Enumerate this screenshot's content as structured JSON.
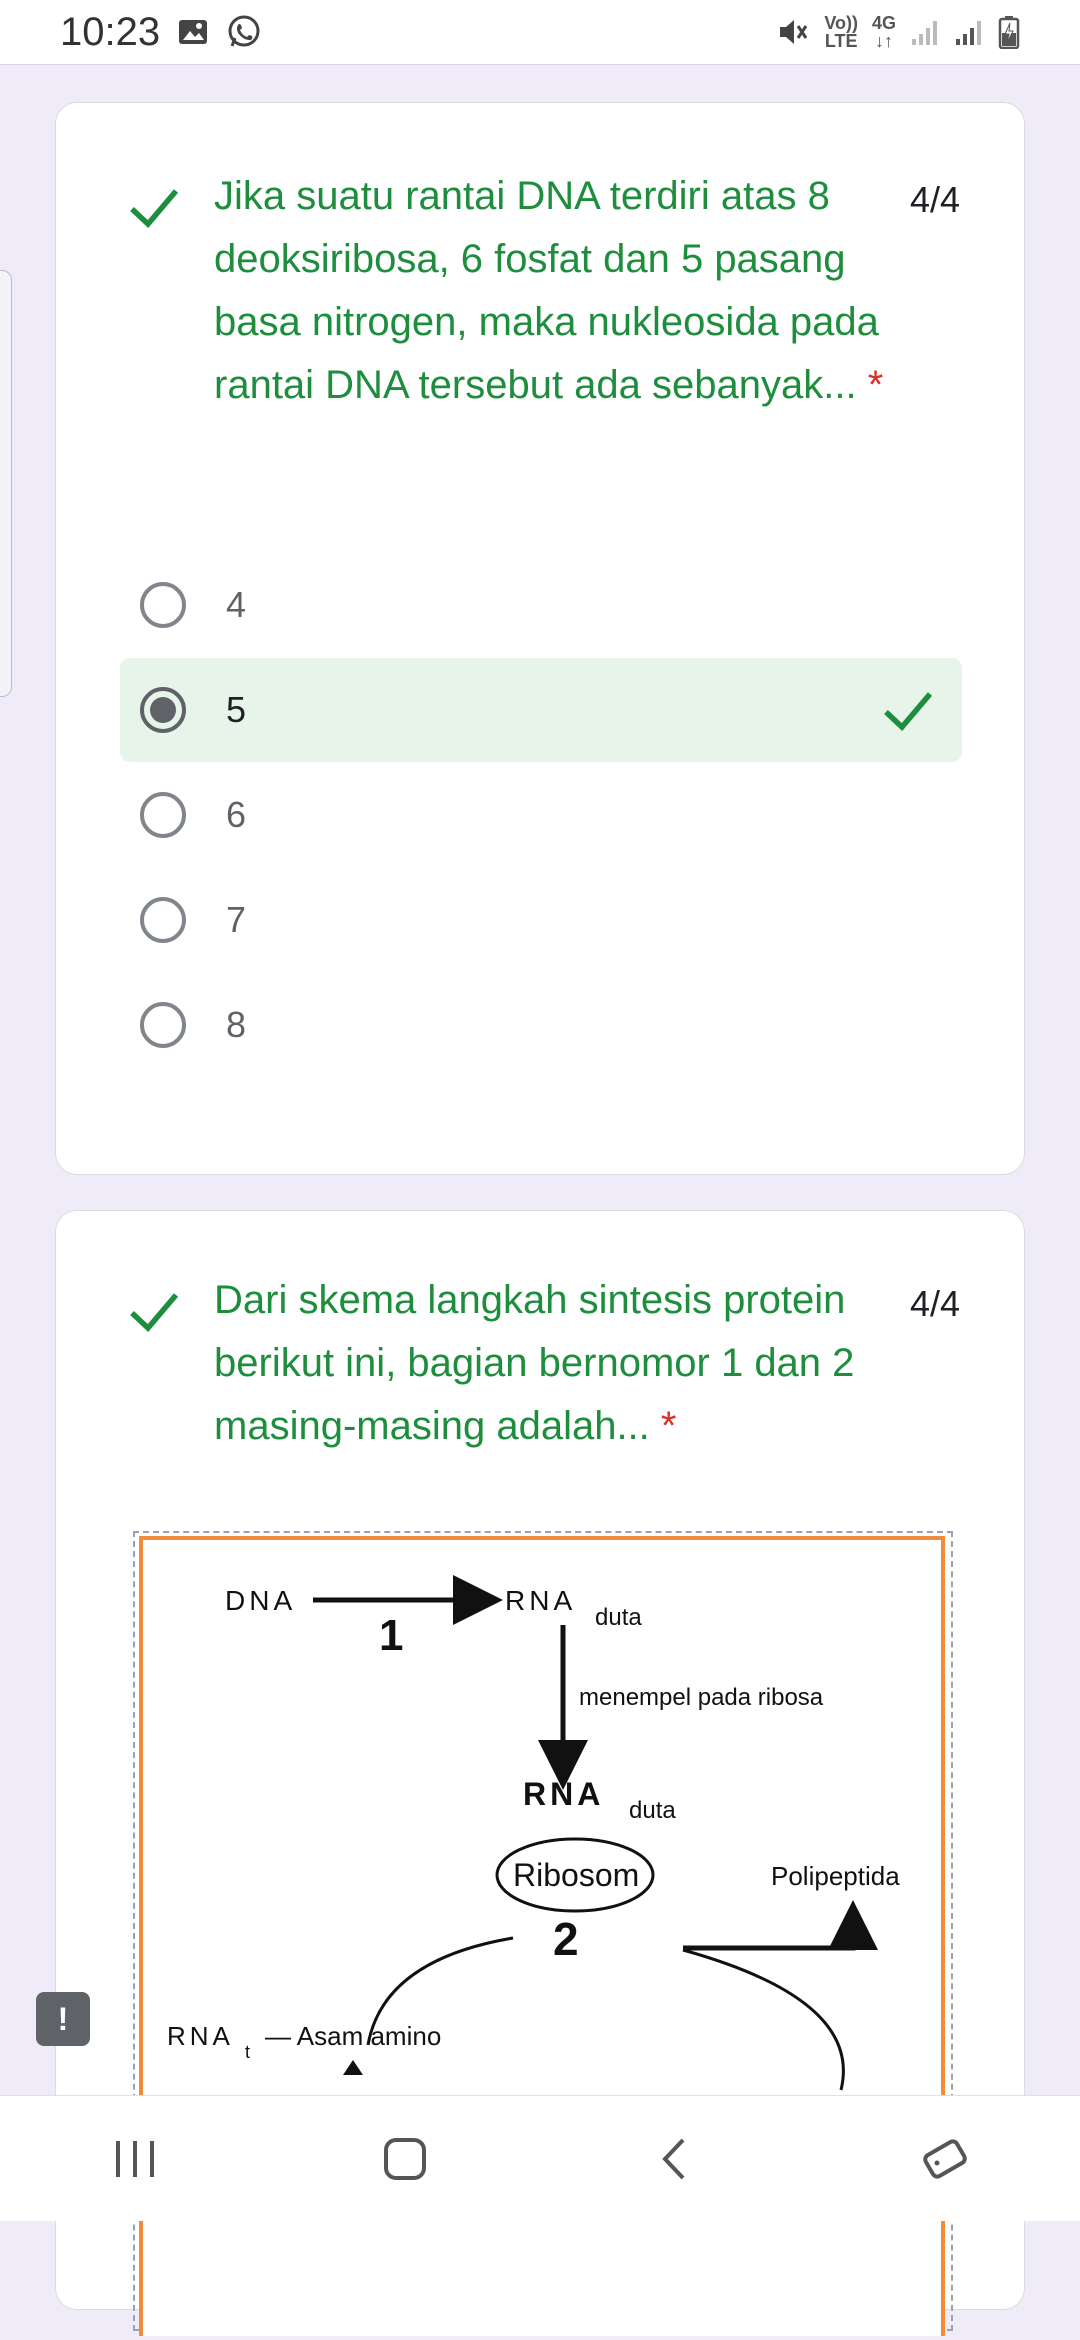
{
  "status_bar": {
    "time": "10:23",
    "network_volte": "Vo))",
    "network_lte": "LTE",
    "network_4g": "4G",
    "icons": [
      "gallery-icon",
      "whatsapp-icon",
      "mute-icon",
      "signal-icon",
      "signal-icon",
      "battery-charging-icon"
    ]
  },
  "question1": {
    "text": "Jika suatu rantai DNA terdiri atas 8 deoksiribosa, 6 fosfat dan 5 pasang basa nitrogen, maka nukleosida pada rantai DNA tersebut ada sebanyak...",
    "required_mark": "*",
    "score": "4/4",
    "options": [
      {
        "label": "4",
        "selected": false
      },
      {
        "label": "5",
        "selected": true,
        "correct": true
      },
      {
        "label": "6",
        "selected": false
      },
      {
        "label": "7",
        "selected": false
      },
      {
        "label": "8",
        "selected": false
      }
    ]
  },
  "question2": {
    "text": "Dari skema langkah sintesis protein berikut ini, bagian bernomor 1 dan 2 masing-masing adalah...",
    "required_mark": "*",
    "score": "4/4",
    "diagram": {
      "dna": "DNA",
      "num1": "1",
      "rna": "RNA",
      "duta": "duta",
      "attach": "menempel pada ribosa",
      "rna2": "RNA",
      "duta2": "duta",
      "ribosom": "Ribosom",
      "num2": "2",
      "polipeptida": "Polipeptida",
      "rna_t": "RNA",
      "t_sub": "t",
      "asam_amino": "— Asam amino"
    }
  },
  "alert_badge": "!",
  "colors": {
    "correct_green": "#1e8e3e",
    "background": "#f0ebf8",
    "selected_bg": "#e6f4ea",
    "required_red": "#d93025",
    "diagram_border": "#f08c3c"
  }
}
